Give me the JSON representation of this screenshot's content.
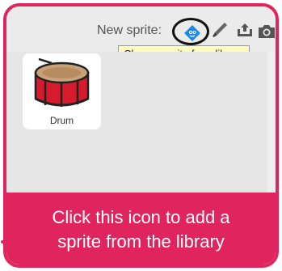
{
  "header": {
    "new_sprite_label": "New sprite:",
    "icons": [
      "choose-sprite-from-library-icon",
      "paint-new-sprite-icon",
      "upload-sprite-icon",
      "camera-icon"
    ]
  },
  "tooltip": {
    "text": "Choose sprite from library"
  },
  "sprites": [
    {
      "name": "Drum",
      "icon": "drum-icon"
    }
  ],
  "callout": {
    "line1": "Click this icon to add a",
    "line2": "sprite from the library"
  },
  "colors": {
    "accent": "#e0245e",
    "tooltip_bg": "#fffcc0",
    "library_icon": "#1e88e5",
    "drum_red": "#d81b2c"
  }
}
